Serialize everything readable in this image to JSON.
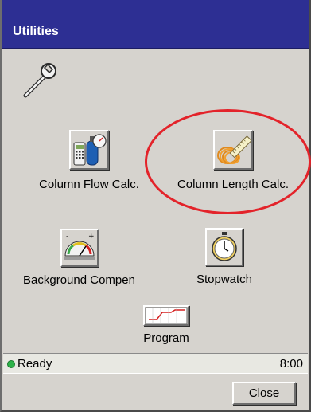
{
  "window": {
    "title": "Utilities"
  },
  "tools": {
    "column_flow": {
      "label": "Column Flow Calc.",
      "icon": "gas-cylinder-calculator-icon"
    },
    "column_length": {
      "label": "Column Length Calc.",
      "icon": "coiled-column-ruler-icon",
      "highlighted": true
    },
    "background_compen": {
      "label": "Background Compen",
      "icon": "gauge-meter-icon"
    },
    "stopwatch": {
      "label": "Stopwatch",
      "icon": "stopwatch-icon"
    },
    "program": {
      "label": "Program",
      "icon": "program-graph-icon"
    }
  },
  "status": {
    "text": "Ready",
    "time": "8:00",
    "indicator_color": "#2eb34a"
  },
  "footer": {
    "close_label": "Close"
  },
  "colors": {
    "titlebar": "#2d2f93",
    "highlight_ring": "#e3232a",
    "panel": "#d6d3ce"
  }
}
